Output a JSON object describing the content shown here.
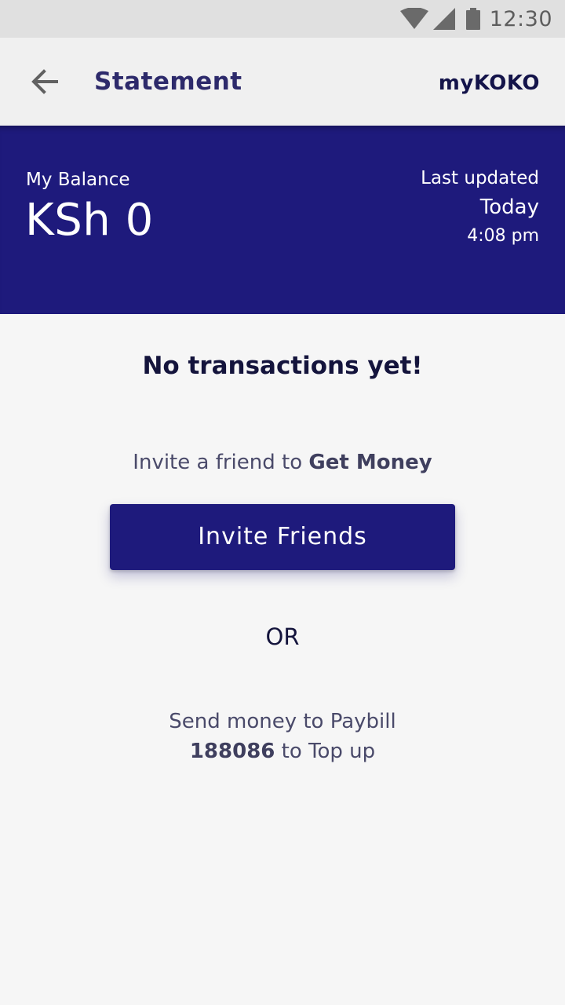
{
  "status_bar": {
    "time": "12:30",
    "icons": [
      "wifi-icon",
      "signal-icon",
      "battery-icon"
    ]
  },
  "app_bar": {
    "back_icon": "arrow-back-icon",
    "title": "Statement",
    "brand": "myKOKO"
  },
  "balance": {
    "label": "My Balance",
    "amount": "KSh 0",
    "updated_label": "Last updated",
    "updated_day": "Today",
    "updated_time": "4:08 pm"
  },
  "empty_state": {
    "title": "No transactions yet!",
    "invite_prefix": "Invite a friend to ",
    "invite_emphasis": "Get Money",
    "invite_button": "Invite Friends",
    "or_label": "OR",
    "paybill_line1": "Send money to Paybill",
    "paybill_number": "188086",
    "paybill_suffix": " to Top up"
  },
  "colors": {
    "primary": "#1e1a7c",
    "status_bar": "#e0e0e0",
    "app_bar": "#f0f0f0",
    "background": "#f6f6f6",
    "title_text": "#2d2a6b"
  }
}
